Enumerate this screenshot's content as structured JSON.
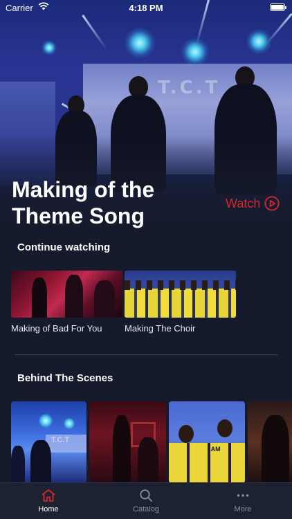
{
  "status_bar": {
    "carrier": "Carrier",
    "time": "4:18 PM"
  },
  "hero": {
    "title": "Making of the Theme Song",
    "watch_label": "Watch",
    "screen_text": "T.C.T"
  },
  "continue_watching": {
    "heading": "Continue watching",
    "items": [
      {
        "label": "Making of Bad For You"
      },
      {
        "label": "Making The Choir"
      }
    ]
  },
  "behind_the_scenes": {
    "heading": "Behind The Scenes",
    "items": [
      {
        "thumb_text": "T.C.T"
      },
      {
        "thumb_text": ""
      },
      {
        "thumb_text": "I AM"
      },
      {
        "thumb_text": ""
      }
    ]
  },
  "tab_bar": {
    "tabs": [
      {
        "label": "Home",
        "icon": "home-icon",
        "active": true
      },
      {
        "label": "Catalog",
        "icon": "search-icon",
        "active": false
      },
      {
        "label": "More",
        "icon": "more-icon",
        "active": false
      }
    ]
  },
  "colors": {
    "accent": "#d8262c",
    "background": "#151b2c",
    "tab_bar": "#1c2232"
  }
}
